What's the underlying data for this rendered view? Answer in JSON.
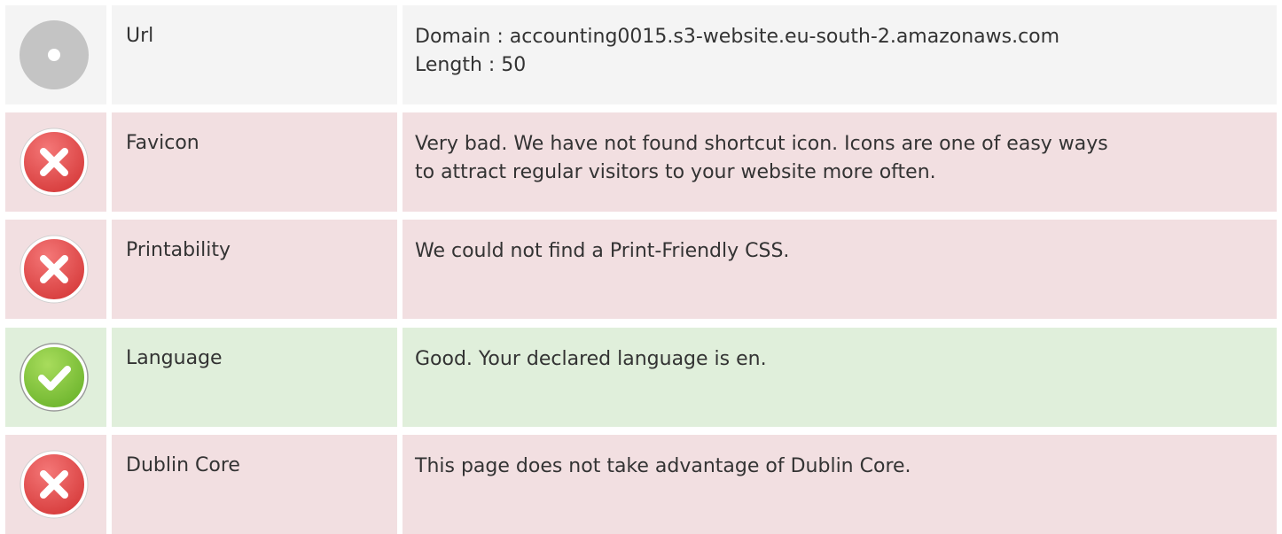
{
  "rows": [
    {
      "status": "neutral",
      "icon": "neutral-circle-icon",
      "label": "Url",
      "lines": [
        "Domain : accounting0015.s3-website.eu-south-2.amazonaws.com",
        "Length : 50"
      ]
    },
    {
      "status": "bad",
      "icon": "error-x-icon",
      "label": "Favicon",
      "lines": [
        "Very bad. We have not found shortcut icon. Icons are one of easy ways",
        "to attract regular visitors to your website more often."
      ]
    },
    {
      "status": "bad",
      "icon": "error-x-icon",
      "label": "Printability",
      "lines": [
        "We could not find a Print-Friendly CSS."
      ]
    },
    {
      "status": "good",
      "icon": "success-check-icon",
      "label": "Language",
      "lines": [
        "Good. Your declared language is en."
      ]
    },
    {
      "status": "bad",
      "icon": "error-x-icon",
      "label": "Dublin Core",
      "lines": [
        "This page does not take advantage of Dublin Core."
      ]
    }
  ],
  "colors": {
    "neutral_bg": "#f4f4f4",
    "bad_bg": "#f2dfe1",
    "good_bg": "#e0efdb",
    "error_red": "#e04848",
    "success_green": "#7fc63a",
    "neutral_gray": "#c4c4c4"
  }
}
